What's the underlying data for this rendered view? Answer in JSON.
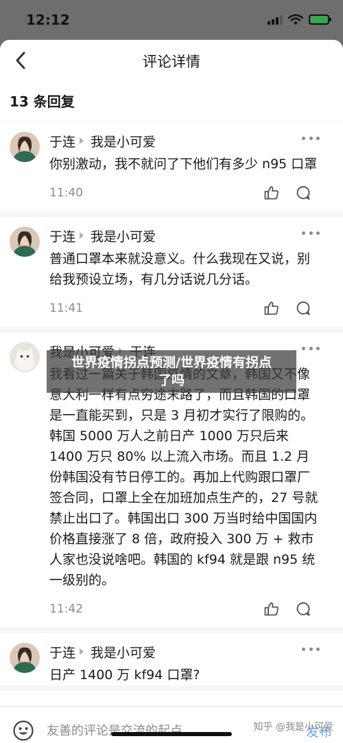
{
  "status_bar": {
    "time": "12:12"
  },
  "header": {
    "title": "评论详情",
    "back_icon": "chevron-left-icon"
  },
  "reply_count": "13 条回复",
  "comments": [
    {
      "author": "于连",
      "reply_to": "我是小可爱",
      "text": "你别激动，我不就问了下他们有多少 n95 口罩",
      "time": "11:40",
      "avatar": "avatar-girl"
    },
    {
      "author": "于连",
      "reply_to": "我是小可爱",
      "text": "普通口罩本来就没意义。什么我现在又说，别给我预设立场，有几分话说几分话。",
      "time": "11:41",
      "avatar": "avatar-girl"
    },
    {
      "author": "我是小可爱",
      "reply_to": "于连",
      "text": "我看过一篇关于韩国疫情的文章，韩国又不像意大利一样有点穷途末路了，而且韩国的口罩是一直能买到，只是 3 月初才实行了限购的。韩国 5000 万人之前日产 1000 万只后来 1400 万只 80% 以上流入市场。而且 1.2 月份韩国没有节日停工的。再加上代购跟口罩厂签合同，口罩上全在加班加点生产的，27 号就禁止出口了。韩国出口 300 万当时给中国国内价格直接涨了 8 倍，政府投入 300 万 + 救市人家也没说啥吧。韩国的 kf94 就是跟 n95 统一级别的。",
      "time": "11:42",
      "avatar": "avatar-cat"
    },
    {
      "author": "于连",
      "reply_to": "我是小可爱",
      "text": "日产 1400 万 kf94 口罩?",
      "time": "",
      "avatar": "avatar-girl"
    }
  ],
  "banner": {
    "line1": "世界疫情拐点预测/世界疫情有拐点",
    "line2": "了吗"
  },
  "input_bar": {
    "placeholder": "友善的评论是交流的起点",
    "publish_label": "发布"
  },
  "source_mark": "知乎 @我是小可爱",
  "colors": {
    "accent": "#6fa8f0",
    "muted": "#8a8a8a",
    "battery": "#2fb14a"
  }
}
